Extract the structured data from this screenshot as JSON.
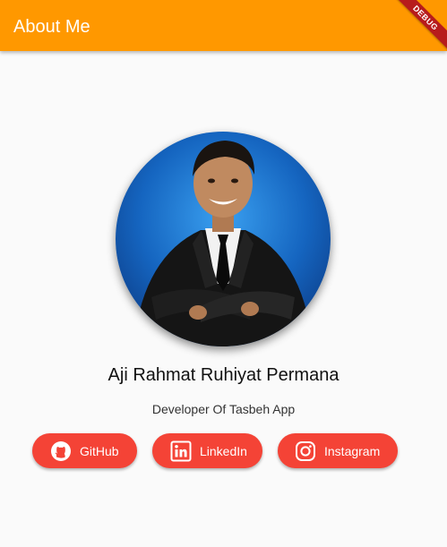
{
  "appbar": {
    "title": "About Me",
    "color": "#ff9800"
  },
  "debug_banner": {
    "label": "DEBUG"
  },
  "profile": {
    "name": "Aji Rahmat Ruhiyat Permana",
    "role": "Developer Of Tasbeh App"
  },
  "buttons": [
    {
      "label": "GitHub",
      "icon": "github-icon"
    },
    {
      "label": "LinkedIn",
      "icon": "linkedin-icon"
    },
    {
      "label": "Instagram",
      "icon": "instagram-icon"
    }
  ],
  "colors": {
    "button_bg": "#f44336",
    "background": "#fafafa"
  }
}
